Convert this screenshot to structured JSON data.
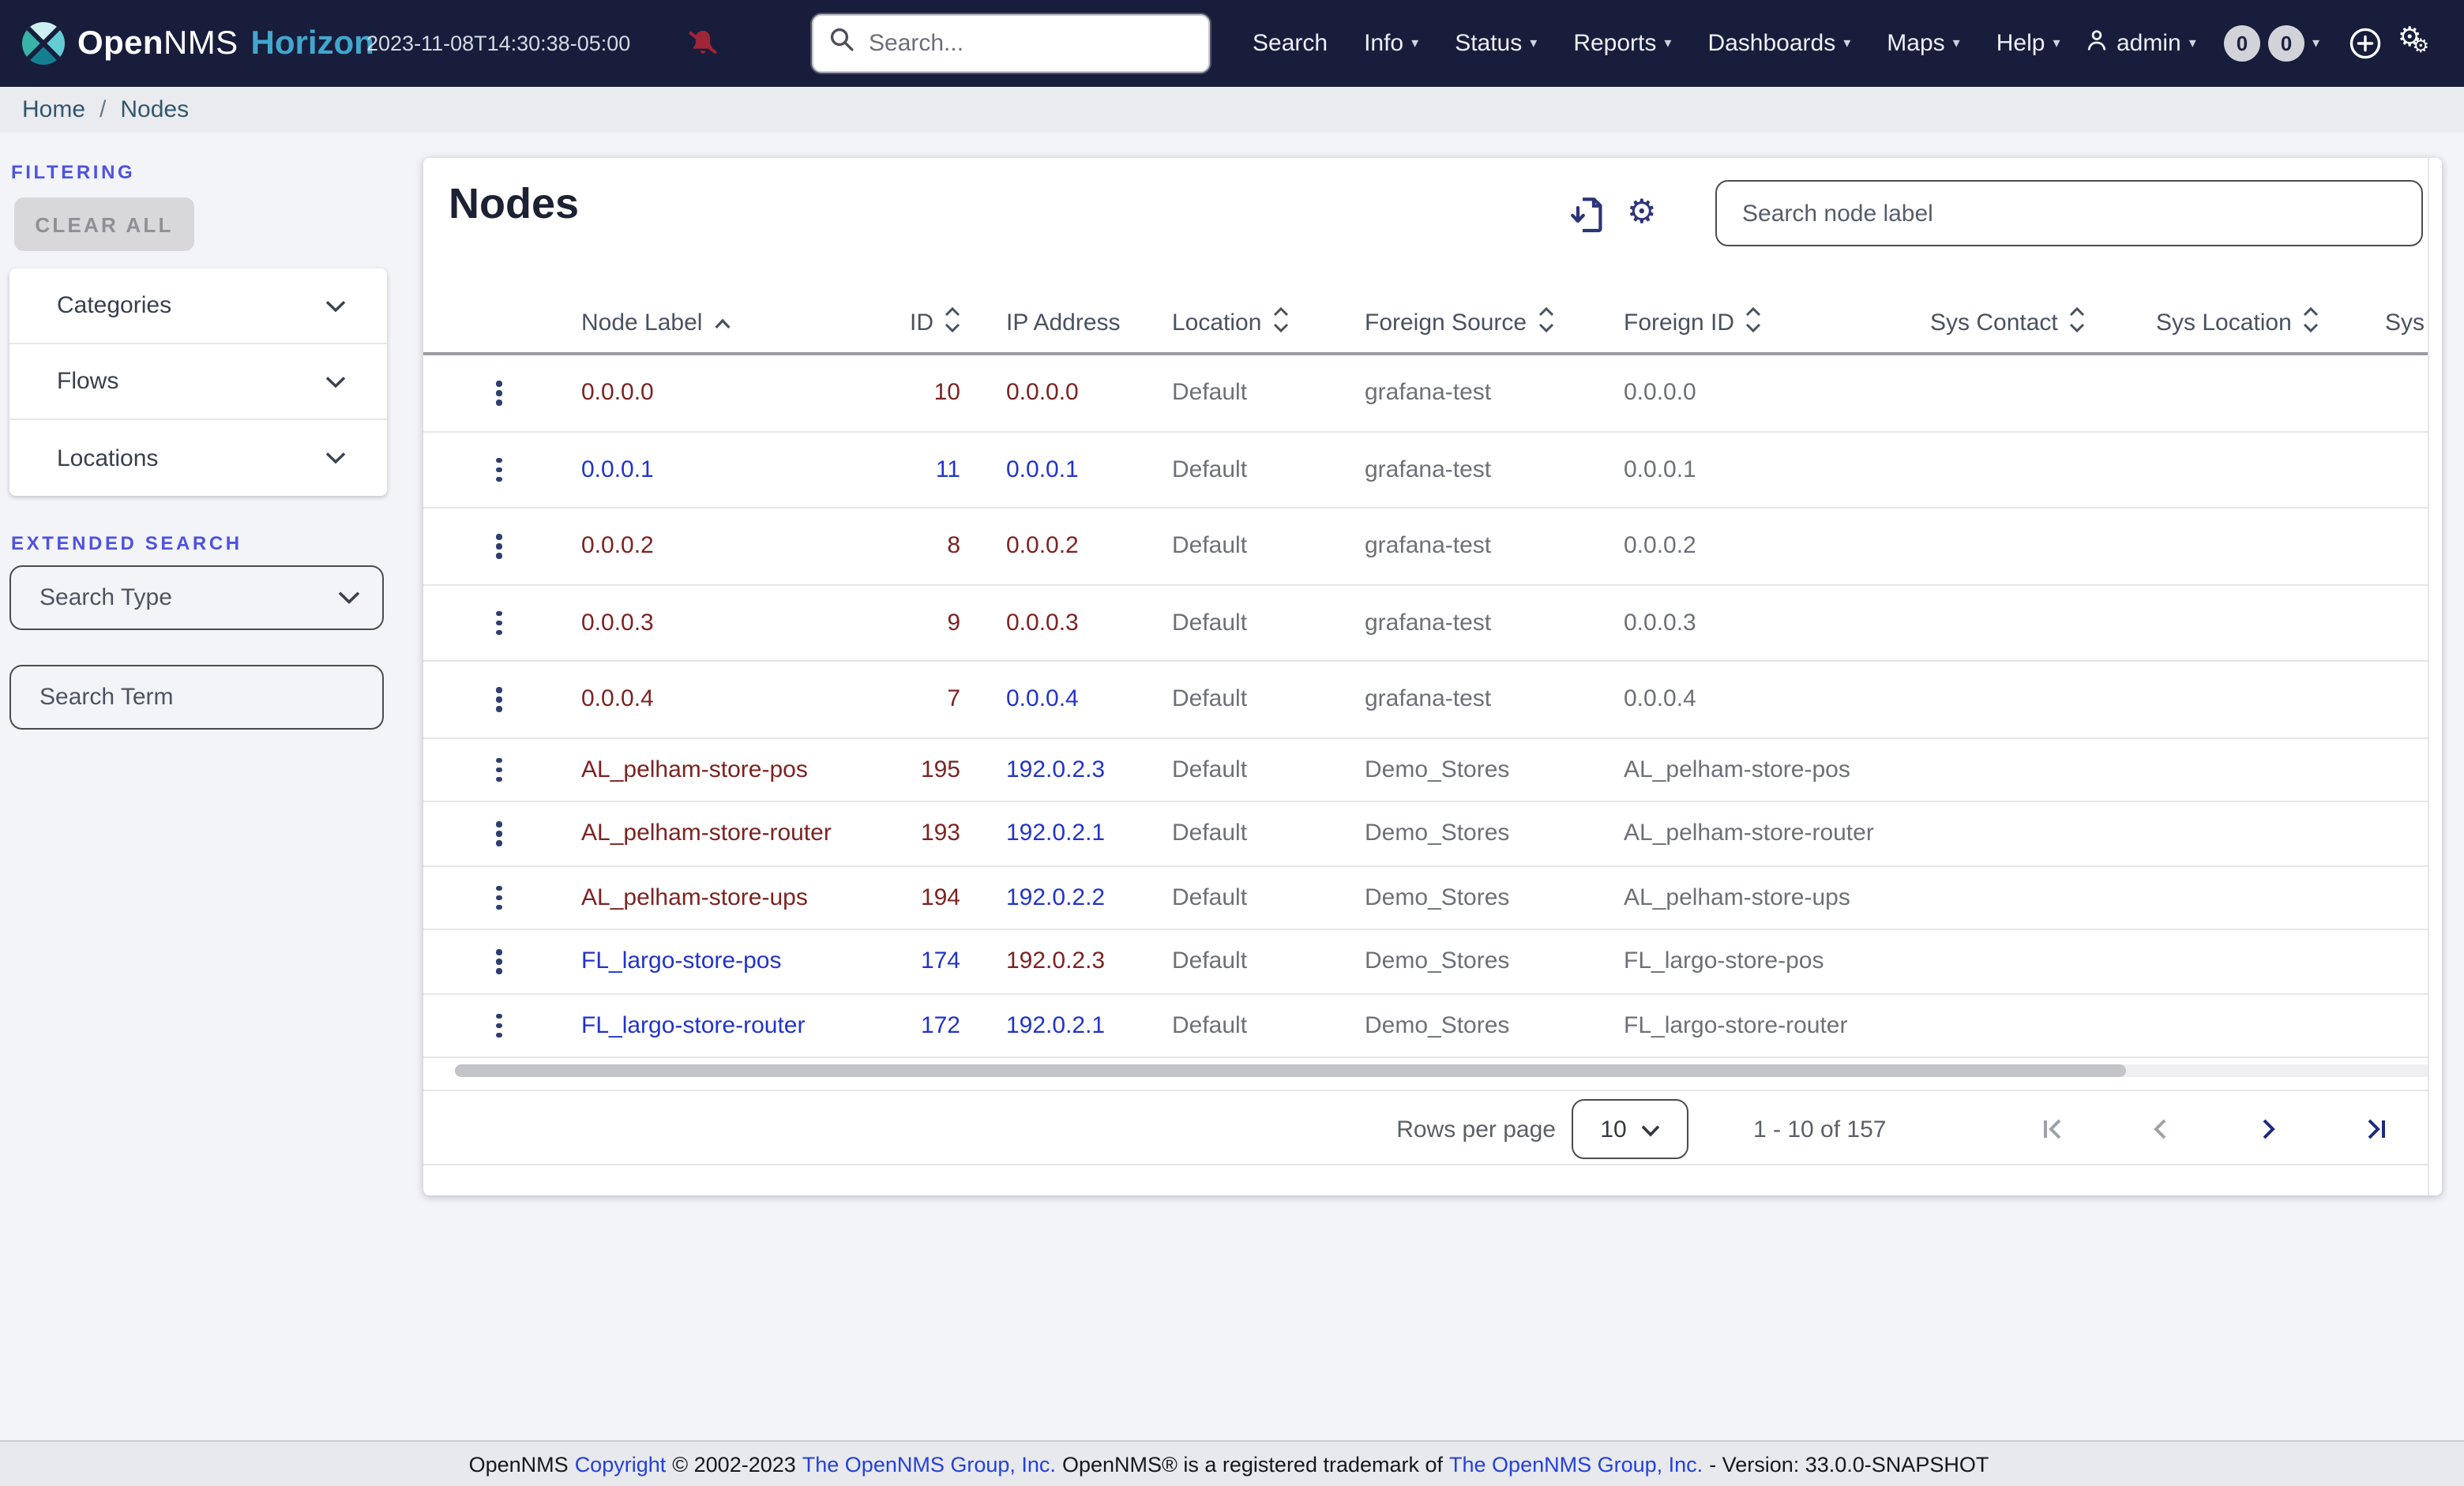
{
  "navbar": {
    "brand": {
      "name_bold": "Open",
      "name_rest": "NMS",
      "product": "Horizon"
    },
    "timestamp": "2023-11-08T14:30:38-05:00",
    "search_placeholder": "Search...",
    "menu": [
      {
        "label": "Search",
        "caret": false
      },
      {
        "label": "Info",
        "caret": true
      },
      {
        "label": "Status",
        "caret": true
      },
      {
        "label": "Reports",
        "caret": true
      },
      {
        "label": "Dashboards",
        "caret": true
      },
      {
        "label": "Maps",
        "caret": true
      },
      {
        "label": "Help",
        "caret": true
      }
    ],
    "user_label": "admin",
    "badges": [
      "0",
      "0"
    ]
  },
  "breadcrumb": {
    "home": "Home",
    "separator": "/",
    "current": "Nodes"
  },
  "sidebar": {
    "filtering_label": "FILTERING",
    "clear_all_label": "CLEAR ALL",
    "accordions": {
      "categories": "Categories",
      "flows": "Flows",
      "locations": "Locations"
    },
    "extended_search_label": "EXTENDED SEARCH",
    "search_type_label": "Search Type",
    "search_term_placeholder": "Search Term"
  },
  "main": {
    "title": "Nodes",
    "search_placeholder": "Search node label",
    "table": {
      "columns": [
        {
          "label": "Node Label",
          "sort": "asc"
        },
        {
          "label": "ID",
          "sort": "both"
        },
        {
          "label": "IP Address",
          "sort": "none"
        },
        {
          "label": "Location",
          "sort": "both"
        },
        {
          "label": "Foreign Source",
          "sort": "both"
        },
        {
          "label": "Foreign ID",
          "sort": "both"
        },
        {
          "label": "Sys Contact",
          "sort": "both"
        },
        {
          "label": "Sys Location",
          "sort": "both"
        },
        {
          "label": "Sys D",
          "sort": "none"
        }
      ],
      "rows": [
        {
          "label": "0.0.0.0",
          "label_style": "visited",
          "id": "10",
          "id_style": "visited",
          "ip": "0.0.0.0",
          "ip_style": "visited",
          "location": "Default",
          "foreign_source": "grafana-test",
          "foreign_id": "0.0.0.0"
        },
        {
          "label": "0.0.0.1",
          "label_style": "new",
          "id": "11",
          "id_style": "new",
          "ip": "0.0.0.1",
          "ip_style": "new",
          "location": "Default",
          "foreign_source": "grafana-test",
          "foreign_id": "0.0.0.1"
        },
        {
          "label": "0.0.0.2",
          "label_style": "visited",
          "id": "8",
          "id_style": "visited",
          "ip": "0.0.0.2",
          "ip_style": "visited",
          "location": "Default",
          "foreign_source": "grafana-test",
          "foreign_id": "0.0.0.2"
        },
        {
          "label": "0.0.0.3",
          "label_style": "visited",
          "id": "9",
          "id_style": "visited",
          "ip": "0.0.0.3",
          "ip_style": "visited",
          "location": "Default",
          "foreign_source": "grafana-test",
          "foreign_id": "0.0.0.3"
        },
        {
          "label": "0.0.0.4",
          "label_style": "visited",
          "id": "7",
          "id_style": "visited",
          "ip": "0.0.0.4",
          "ip_style": "new",
          "location": "Default",
          "foreign_source": "grafana-test",
          "foreign_id": "0.0.0.4"
        },
        {
          "label": "AL_pelham-store-pos",
          "label_style": "visited",
          "id": "195",
          "id_style": "visited",
          "ip": "192.0.2.3",
          "ip_style": "new",
          "location": "Default",
          "foreign_source": "Demo_Stores",
          "foreign_id": "AL_pelham-store-pos"
        },
        {
          "label": "AL_pelham-store-router",
          "label_style": "visited",
          "id": "193",
          "id_style": "visited",
          "ip": "192.0.2.1",
          "ip_style": "new",
          "location": "Default",
          "foreign_source": "Demo_Stores",
          "foreign_id": "AL_pelham-store-router"
        },
        {
          "label": "AL_pelham-store-ups",
          "label_style": "visited",
          "id": "194",
          "id_style": "visited",
          "ip": "192.0.2.2",
          "ip_style": "new",
          "location": "Default",
          "foreign_source": "Demo_Stores",
          "foreign_id": "AL_pelham-store-ups"
        },
        {
          "label": "FL_largo-store-pos",
          "label_style": "new",
          "id": "174",
          "id_style": "new",
          "ip": "192.0.2.3",
          "ip_style": "visited",
          "location": "Default",
          "foreign_source": "Demo_Stores",
          "foreign_id": "FL_largo-store-pos"
        },
        {
          "label": "FL_largo-store-router",
          "label_style": "new",
          "id": "172",
          "id_style": "new",
          "ip": "192.0.2.1",
          "ip_style": "new",
          "location": "Default",
          "foreign_source": "Demo_Stores",
          "foreign_id": "FL_largo-store-router"
        }
      ]
    },
    "pagination": {
      "rows_per_page_label": "Rows per page",
      "rows_per_page_value": "10",
      "range_label": "1 - 10 of 157"
    }
  },
  "footer": {
    "prefix": "OpenNMS",
    "copyright_link": "Copyright",
    "years": "© 2002-2023",
    "group_link": "The OpenNMS Group, Inc.",
    "trademark_text": "OpenNMS® is a registered trademark of",
    "group_link_2": "The OpenNMS Group, Inc.",
    "version_text": "- Version: 33.0.0-SNAPSHOT"
  },
  "colors": {
    "navbar_bg": "#171d3b",
    "horizon_brand": "#42a6cd",
    "accent_indigo": "#4f52e0",
    "visited_link": "#7c2321",
    "new_link": "#2134cb",
    "alert_red": "#a02537",
    "icon_indigo": "#2d3578"
  }
}
